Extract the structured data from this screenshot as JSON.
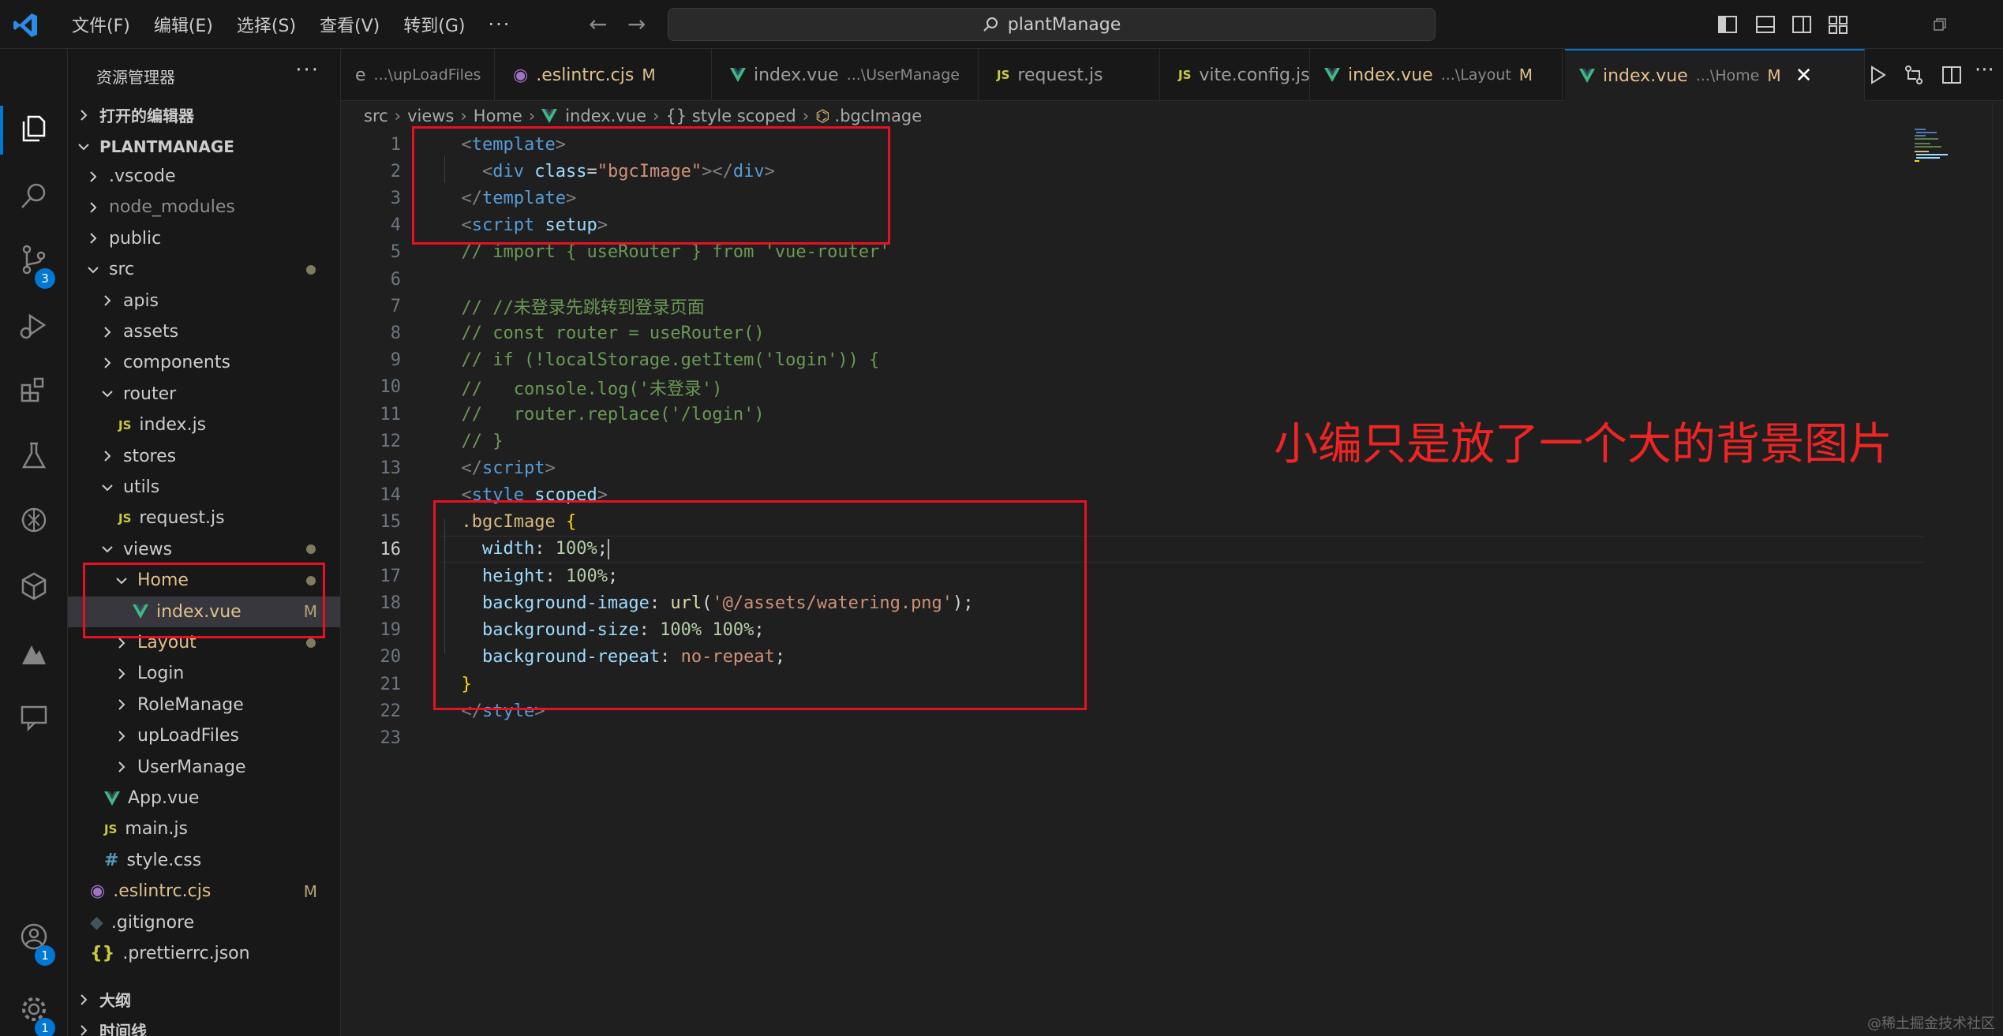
{
  "titlebar": {
    "menus": [
      "文件(F)",
      "编辑(E)",
      "选择(S)",
      "查看(V)",
      "转到(G)"
    ],
    "more": "···",
    "search_text": "plantManage"
  },
  "activity_badges": {
    "source_control": "3",
    "accounts": "1",
    "settings": "1"
  },
  "sidebar": {
    "title": "资源管理器",
    "more": "···",
    "open_editors": "打开的编辑器",
    "project": "PLANTMANAGE",
    "tree": [
      {
        "label": ".vscode",
        "indent": 0,
        "type": "folder-closed",
        "dim": false
      },
      {
        "label": "node_modules",
        "indent": 0,
        "type": "folder-closed",
        "dim": true
      },
      {
        "label": "public",
        "indent": 0,
        "type": "folder-closed",
        "dim": false
      },
      {
        "label": "src",
        "indent": 0,
        "type": "folder-open",
        "dot": true
      },
      {
        "label": "apis",
        "indent": 1,
        "type": "folder-closed"
      },
      {
        "label": "assets",
        "indent": 1,
        "type": "folder-closed"
      },
      {
        "label": "components",
        "indent": 1,
        "type": "folder-closed"
      },
      {
        "label": "router",
        "indent": 1,
        "type": "folder-open"
      },
      {
        "label": "index.js",
        "indent": 2,
        "type": "js"
      },
      {
        "label": "stores",
        "indent": 1,
        "type": "folder-closed"
      },
      {
        "label": "utils",
        "indent": 1,
        "type": "folder-open"
      },
      {
        "label": "request.js",
        "indent": 2,
        "type": "js"
      },
      {
        "label": "views",
        "indent": 1,
        "type": "folder-open",
        "dot": true
      },
      {
        "label": "Home",
        "indent": 2,
        "type": "folder-open",
        "dot": true,
        "modified": true
      },
      {
        "label": "index.vue",
        "indent": 3,
        "type": "vue",
        "badge": "M",
        "modified": true,
        "selected": true
      },
      {
        "label": "Layout",
        "indent": 2,
        "type": "folder-closed",
        "dot": true,
        "modified": true
      },
      {
        "label": "Login",
        "indent": 2,
        "type": "folder-closed"
      },
      {
        "label": "RoleManage",
        "indent": 2,
        "type": "folder-closed"
      },
      {
        "label": "upLoadFiles",
        "indent": 2,
        "type": "folder-closed"
      },
      {
        "label": "UserManage",
        "indent": 2,
        "type": "folder-closed"
      },
      {
        "label": "App.vue",
        "indent": 1,
        "type": "vue"
      },
      {
        "label": "main.js",
        "indent": 1,
        "type": "js"
      },
      {
        "label": "style.css",
        "indent": 1,
        "type": "css"
      },
      {
        "label": ".eslintrc.cjs",
        "indent": 0,
        "type": "eslint",
        "badge": "M",
        "modified": true
      },
      {
        "label": ".gitignore",
        "indent": 0,
        "type": "git"
      },
      {
        "label": ".prettierrc.json",
        "indent": 0,
        "type": "json"
      }
    ],
    "outline": "大纲",
    "timeline": "时间线"
  },
  "tabs": [
    {
      "name": "e",
      "desc": "...\\upLoadFiles",
      "icon": "none"
    },
    {
      "name": ".eslintrc.cjs",
      "modified": "M",
      "icon": "eslint",
      "name_modified": true
    },
    {
      "name": "index.vue",
      "desc": "...\\UserManage",
      "icon": "vue"
    },
    {
      "name": "request.js",
      "icon": "js"
    },
    {
      "name": "vite.config.js",
      "icon": "js"
    },
    {
      "name": "index.vue",
      "desc": "...\\Layout",
      "modified": "M",
      "icon": "vue",
      "name_modified": true
    },
    {
      "name": "index.vue",
      "desc": "...\\Home",
      "modified": "M",
      "icon": "vue",
      "active": true,
      "close": "✕",
      "name_modified": true
    }
  ],
  "breadcrumb": [
    "src",
    "views",
    "Home",
    "index.vue",
    "{} style scoped",
    ".bgcImage"
  ],
  "code_lines": [
    [
      [
        "  ",
        "p"
      ],
      [
        "<",
        "punc"
      ],
      [
        "template",
        "tag"
      ],
      [
        ">",
        "punc"
      ]
    ],
    [
      [
        "    ",
        "p"
      ],
      [
        "<",
        "punc"
      ],
      [
        "div",
        "tag"
      ],
      [
        " ",
        "p"
      ],
      [
        "class",
        "attr"
      ],
      [
        "=",
        "plain"
      ],
      [
        "\"bgcImage\"",
        "str"
      ],
      [
        "></",
        "punc"
      ],
      [
        "div",
        "tag"
      ],
      [
        ">",
        "punc"
      ]
    ],
    [
      [
        "  ",
        "p"
      ],
      [
        "</",
        "punc"
      ],
      [
        "template",
        "tag"
      ],
      [
        ">",
        "punc"
      ]
    ],
    [
      [
        "  ",
        "p"
      ],
      [
        "<",
        "punc"
      ],
      [
        "script",
        "tag"
      ],
      [
        " ",
        "p"
      ],
      [
        "setup",
        "attr"
      ],
      [
        ">",
        "punc"
      ]
    ],
    [
      [
        "  ",
        "p"
      ],
      [
        "// import { useRouter } from 'vue-router'",
        "com"
      ]
    ],
    [
      [
        "",
        "p"
      ]
    ],
    [
      [
        "  ",
        "p"
      ],
      [
        "// //未登录先跳转到登录页面",
        "com"
      ]
    ],
    [
      [
        "  ",
        "p"
      ],
      [
        "// const router = useRouter()",
        "com"
      ]
    ],
    [
      [
        "  ",
        "p"
      ],
      [
        "// if (!localStorage.getItem('login')) {",
        "com"
      ]
    ],
    [
      [
        "  ",
        "p"
      ],
      [
        "//   console.log('未登录')",
        "com"
      ]
    ],
    [
      [
        "  ",
        "p"
      ],
      [
        "//   router.replace('/login')",
        "com"
      ]
    ],
    [
      [
        "  ",
        "p"
      ],
      [
        "// }",
        "com"
      ]
    ],
    [
      [
        "  ",
        "p"
      ],
      [
        "</",
        "punc"
      ],
      [
        "script",
        "tag"
      ],
      [
        ">",
        "punc"
      ]
    ],
    [
      [
        "  ",
        "p"
      ],
      [
        "<",
        "punc"
      ],
      [
        "style",
        "tag"
      ],
      [
        " ",
        "p"
      ],
      [
        "scoped",
        "attr"
      ],
      [
        ">",
        "punc"
      ]
    ],
    [
      [
        "  ",
        "p"
      ],
      [
        ".bgcImage",
        "sel"
      ],
      [
        " ",
        "p"
      ],
      [
        "{",
        "brace"
      ]
    ],
    [
      [
        "    ",
        "p"
      ],
      [
        "width",
        "prop"
      ],
      [
        ": ",
        "plain"
      ],
      [
        "100%",
        "num"
      ],
      [
        ";",
        "plain"
      ],
      [
        "CURSOR",
        "cursor"
      ]
    ],
    [
      [
        "    ",
        "p"
      ],
      [
        "height",
        "prop"
      ],
      [
        ": ",
        "plain"
      ],
      [
        "100%",
        "num"
      ],
      [
        ";",
        "plain"
      ]
    ],
    [
      [
        "    ",
        "p"
      ],
      [
        "background-image",
        "prop"
      ],
      [
        ": ",
        "plain"
      ],
      [
        "url",
        "fn"
      ],
      [
        "(",
        "plain"
      ],
      [
        "'@/assets/watering.png'",
        "str"
      ],
      [
        ");",
        "plain"
      ]
    ],
    [
      [
        "    ",
        "p"
      ],
      [
        "background-size",
        "prop"
      ],
      [
        ": ",
        "plain"
      ],
      [
        "100%",
        "num"
      ],
      [
        " ",
        "p"
      ],
      [
        "100%",
        "num"
      ],
      [
        ";",
        "plain"
      ]
    ],
    [
      [
        "    ",
        "p"
      ],
      [
        "background-repeat",
        "prop"
      ],
      [
        ": ",
        "plain"
      ],
      [
        "no-repeat",
        "str"
      ],
      [
        ";",
        "plain"
      ]
    ],
    [
      [
        "  ",
        "p"
      ],
      [
        "}",
        "brace"
      ]
    ],
    [
      [
        "  ",
        "p"
      ],
      [
        "</",
        "punc"
      ],
      [
        "style",
        "tag"
      ],
      [
        ">",
        "punc"
      ]
    ],
    [
      [
        "",
        "p"
      ]
    ]
  ],
  "current_line": 16,
  "annotation": "小编只是放了一个大的背景图片",
  "watermark": "@稀土掘金技术社区"
}
